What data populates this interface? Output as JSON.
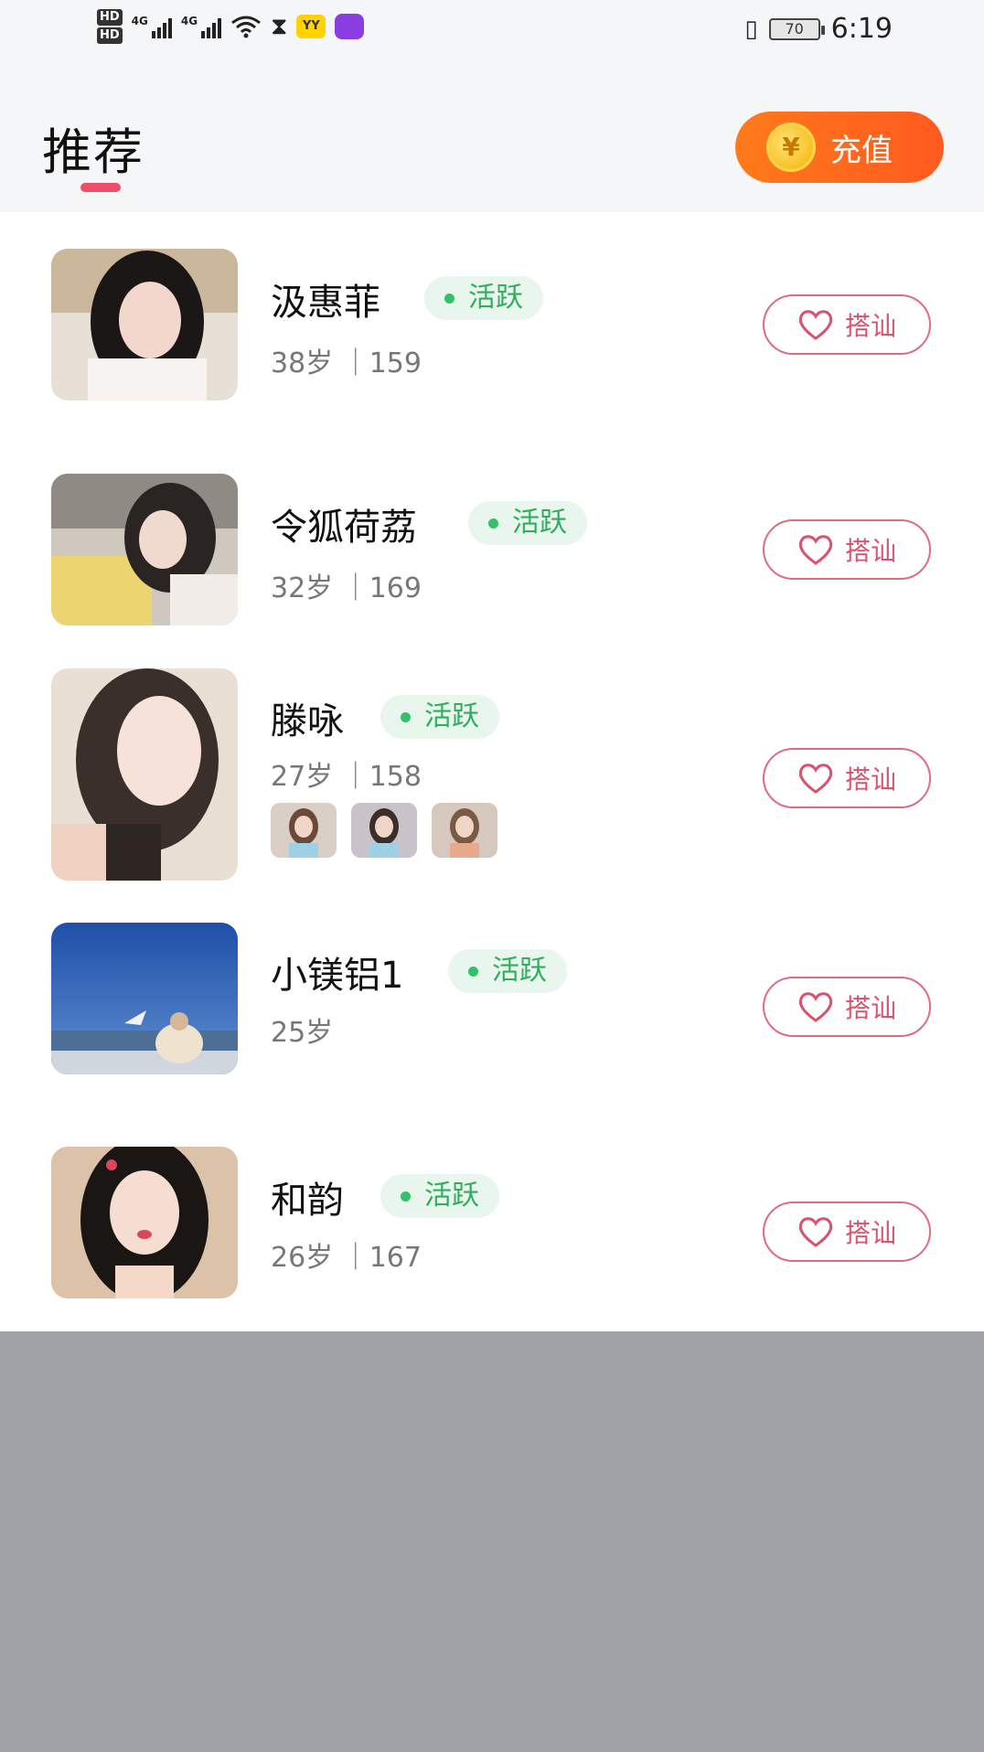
{
  "status_bar": {
    "hd1": "HD",
    "hd2": "HD",
    "net1": "4G",
    "net2": "4G",
    "yy": "YY",
    "battery": "70",
    "time": "6:19"
  },
  "header": {
    "title": "推荐",
    "recharge_label": "充值",
    "coin_symbol": "¥"
  },
  "colors": {
    "accent_pink": "#ef4d6a",
    "recharge_orange": "#ff6a1f",
    "active_green": "#2fae5e"
  },
  "users": [
    {
      "name": "汲惠菲",
      "status": "活跃",
      "meta": "38岁 ｜159",
      "action": "搭讪"
    },
    {
      "name": "令狐荷荔",
      "status": "活跃",
      "meta": "32岁 ｜169",
      "action": "搭讪"
    },
    {
      "name": "滕咏",
      "status": "活跃",
      "meta": "27岁 ｜158",
      "action": "搭讪"
    },
    {
      "name": "小镁铝1",
      "status": "活跃",
      "meta": "25岁",
      "action": "搭讪"
    },
    {
      "name": "和韵",
      "status": "活跃",
      "meta": "26岁 ｜167",
      "action": "搭讪"
    }
  ]
}
